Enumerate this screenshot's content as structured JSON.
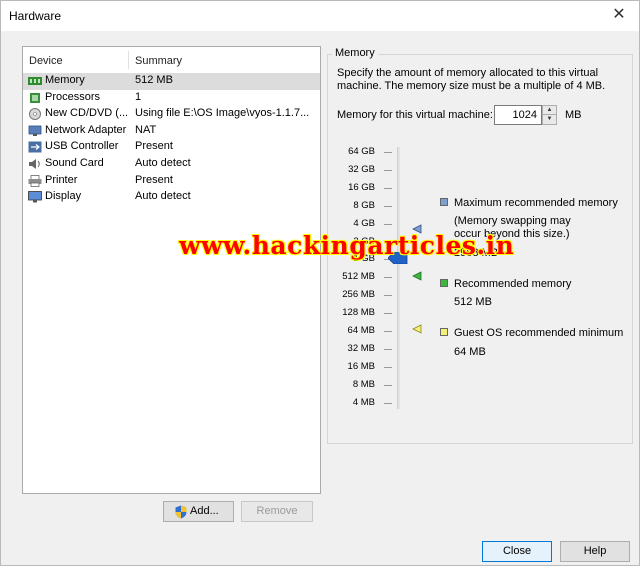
{
  "window": {
    "title": "Hardware",
    "close_glyph": "✕"
  },
  "device_list": {
    "col_device": "Device",
    "col_summary": "Summary",
    "rows": [
      {
        "icon": "memory-icon",
        "device": "Memory",
        "summary": "512 MB",
        "selected": true
      },
      {
        "icon": "processor-icon",
        "device": "Processors",
        "summary": "1"
      },
      {
        "icon": "cd-dvd-icon",
        "device": "New CD/DVD (...",
        "summary": "Using file E:\\OS Image\\vyos-1.1.7..."
      },
      {
        "icon": "network-adapter-icon",
        "device": "Network Adapter",
        "summary": "NAT"
      },
      {
        "icon": "usb-icon",
        "device": "USB Controller",
        "summary": "Present"
      },
      {
        "icon": "sound-card-icon",
        "device": "Sound Card",
        "summary": "Auto detect"
      },
      {
        "icon": "printer-icon",
        "device": "Printer",
        "summary": "Present"
      },
      {
        "icon": "display-icon",
        "device": "Display",
        "summary": "Auto detect"
      }
    ]
  },
  "buttons": {
    "add": "Add...",
    "remove": "Remove",
    "close": "Close",
    "help": "Help"
  },
  "memory": {
    "legend": "Memory",
    "desc_line1": "Specify the amount of memory allocated to this virtual",
    "desc_line2": "machine. The memory size must be a multiple of 4 MB.",
    "label": "Memory for this virtual machine:",
    "value": "1024",
    "unit": "MB",
    "ticks": [
      "64 GB",
      "32 GB",
      "16 GB",
      "8 GB",
      "4 GB",
      "2 GB",
      "1 GB",
      "512 MB",
      "256 MB",
      "128 MB",
      "64 MB",
      "32 MB",
      "16 MB",
      "8 MB",
      "4 MB"
    ],
    "max_title": "Maximum recommended memory",
    "max_note1": "(Memory swapping may",
    "max_note2": "occur beyond this size.)",
    "max_value": "2988 MB",
    "rec_title": "Recommended memory",
    "rec_value": "512 MB",
    "min_title": "Guest OS recommended minimum",
    "min_value": "64 MB",
    "colors": {
      "max": "#7f9fd0",
      "rec": "#3fb53f",
      "min": "#f4f07a",
      "thumb": "#1f62c8"
    }
  },
  "watermark": "www.hackingarticles.in"
}
